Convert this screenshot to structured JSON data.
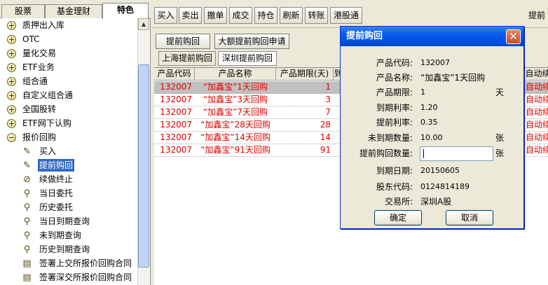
{
  "left_tabs": [
    "股票",
    "基金理财",
    "特色"
  ],
  "tree": {
    "top_items": [
      {
        "label": "质押出入库",
        "expanded": false
      },
      {
        "label": "OTC",
        "expanded": false
      },
      {
        "label": "量化交易",
        "expanded": false
      },
      {
        "label": "ETF业务",
        "expanded": false
      },
      {
        "label": "组合通",
        "expanded": false
      },
      {
        "label": "自定义组合通",
        "expanded": false
      },
      {
        "label": "全国股转",
        "expanded": false
      },
      {
        "label": "ETF网下认购",
        "expanded": false
      },
      {
        "label": "报价回购",
        "expanded": true
      }
    ],
    "children": [
      {
        "label": "买入",
        "icon": "buy-icon"
      },
      {
        "label": "提前购回",
        "icon": "buy-back-icon",
        "selected": true
      },
      {
        "label": "续做终止",
        "icon": "renew-stop-icon"
      },
      {
        "label": "当日委托",
        "icon": "magnifier-icon"
      },
      {
        "label": "历史委托",
        "icon": "magnifier-icon"
      },
      {
        "label": "当日到期查询",
        "icon": "magnifier-icon"
      },
      {
        "label": "未到期查询",
        "icon": "magnifier-icon"
      },
      {
        "label": "历史到期查询",
        "icon": "magnifier-icon"
      },
      {
        "label": "签署上交所报价回购合同",
        "icon": "document-icon"
      },
      {
        "label": "签署深交所报价回购合同",
        "icon": "document-icon"
      }
    ]
  },
  "toolbar": {
    "buttons": [
      "买入",
      "卖出",
      "撤单",
      "成交",
      "持仓",
      "刷新",
      "转账",
      "港股通"
    ],
    "title": "提前"
  },
  "content": {
    "btn_early": "提前购回",
    "btn_large": "大额提前购回申请",
    "subtabs": [
      "上海提前购回",
      "深圳提前购回"
    ],
    "active_subtab": 1
  },
  "grid": {
    "headers": [
      "产品代码",
      "产品名称",
      "产品期限(天)",
      "到",
      "自动续"
    ],
    "rows": [
      {
        "code": "132007",
        "name": "“加鑫宝”1天回购",
        "days": "1",
        "auto": "自动续",
        "selected": true
      },
      {
        "code": "132007",
        "name": "“加鑫宝”3天回购",
        "days": "3",
        "auto": "自动续"
      },
      {
        "code": "132007",
        "name": "“加鑫宝”7天回购",
        "days": "7",
        "auto": "自动续"
      },
      {
        "code": "132007",
        "name": "“加鑫宝”28天回购",
        "days": "28",
        "auto": "自动续"
      },
      {
        "code": "132007",
        "name": "“加鑫宝”14天回购",
        "days": "14",
        "auto": "自动续"
      },
      {
        "code": "132007",
        "name": "“加鑫宝”91天回购",
        "days": "91",
        "auto": "自动续"
      }
    ]
  },
  "dialog": {
    "title": "提前购回",
    "fields": [
      {
        "label": "产品代码:",
        "value": "132007",
        "unit": ""
      },
      {
        "label": "产品名称:",
        "value": "“加鑫宝”1天回购",
        "unit": ""
      },
      {
        "label": "产品期限:",
        "value": "1",
        "unit": "天"
      },
      {
        "label": "到期利率:",
        "value": "1.20",
        "unit": ""
      },
      {
        "label": "提前利率:",
        "value": "0.35",
        "unit": ""
      },
      {
        "label": "未到期数量:",
        "value": "10.00",
        "unit": "张"
      },
      {
        "label": "提前购回数量:",
        "value": "",
        "unit": "张"
      },
      {
        "label": "到期日期:",
        "value": "20150605",
        "unit": ""
      },
      {
        "label": "股东代码:",
        "value": "0124814189",
        "unit": ""
      },
      {
        "label": "交易所:",
        "value": "深圳A股",
        "unit": ""
      }
    ],
    "ok": "确定",
    "cancel": "取消"
  }
}
